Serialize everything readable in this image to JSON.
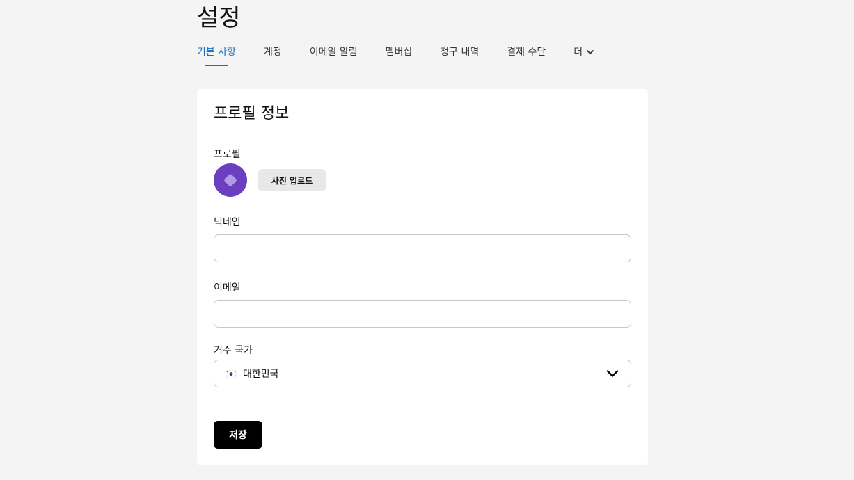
{
  "page": {
    "title": "설정"
  },
  "tabs": [
    {
      "label": "기본 사항",
      "active": true
    },
    {
      "label": "계정",
      "active": false
    },
    {
      "label": "이메일 알림",
      "active": false
    },
    {
      "label": "멤버십",
      "active": false
    },
    {
      "label": "청구 내역",
      "active": false
    },
    {
      "label": "결제 수단",
      "active": false
    },
    {
      "label": "더",
      "active": false,
      "icon": "chevron-down-icon"
    }
  ],
  "profile_card": {
    "title": "프로필 정보",
    "profile_label": "프로필",
    "avatar_icon": "diamond-logo-icon",
    "upload_button_label": "사진 업로드",
    "nickname_label": "닉네임",
    "nickname_value": "",
    "email_label": "이메일",
    "email_value": "",
    "country_label": "거주 국가",
    "country_value": "대한민국",
    "country_flag_icon": "south-korea-flag-icon",
    "country_dropdown_icon": "chevron-down-icon",
    "save_button_label": "저장"
  },
  "colors": {
    "page_background": "#f4f4f4",
    "card_background": "#ffffff",
    "active_tab": "#1a6fc2",
    "avatar": "#6b3fc0",
    "save_button": "#000000",
    "upload_button": "#e8e8e8"
  }
}
